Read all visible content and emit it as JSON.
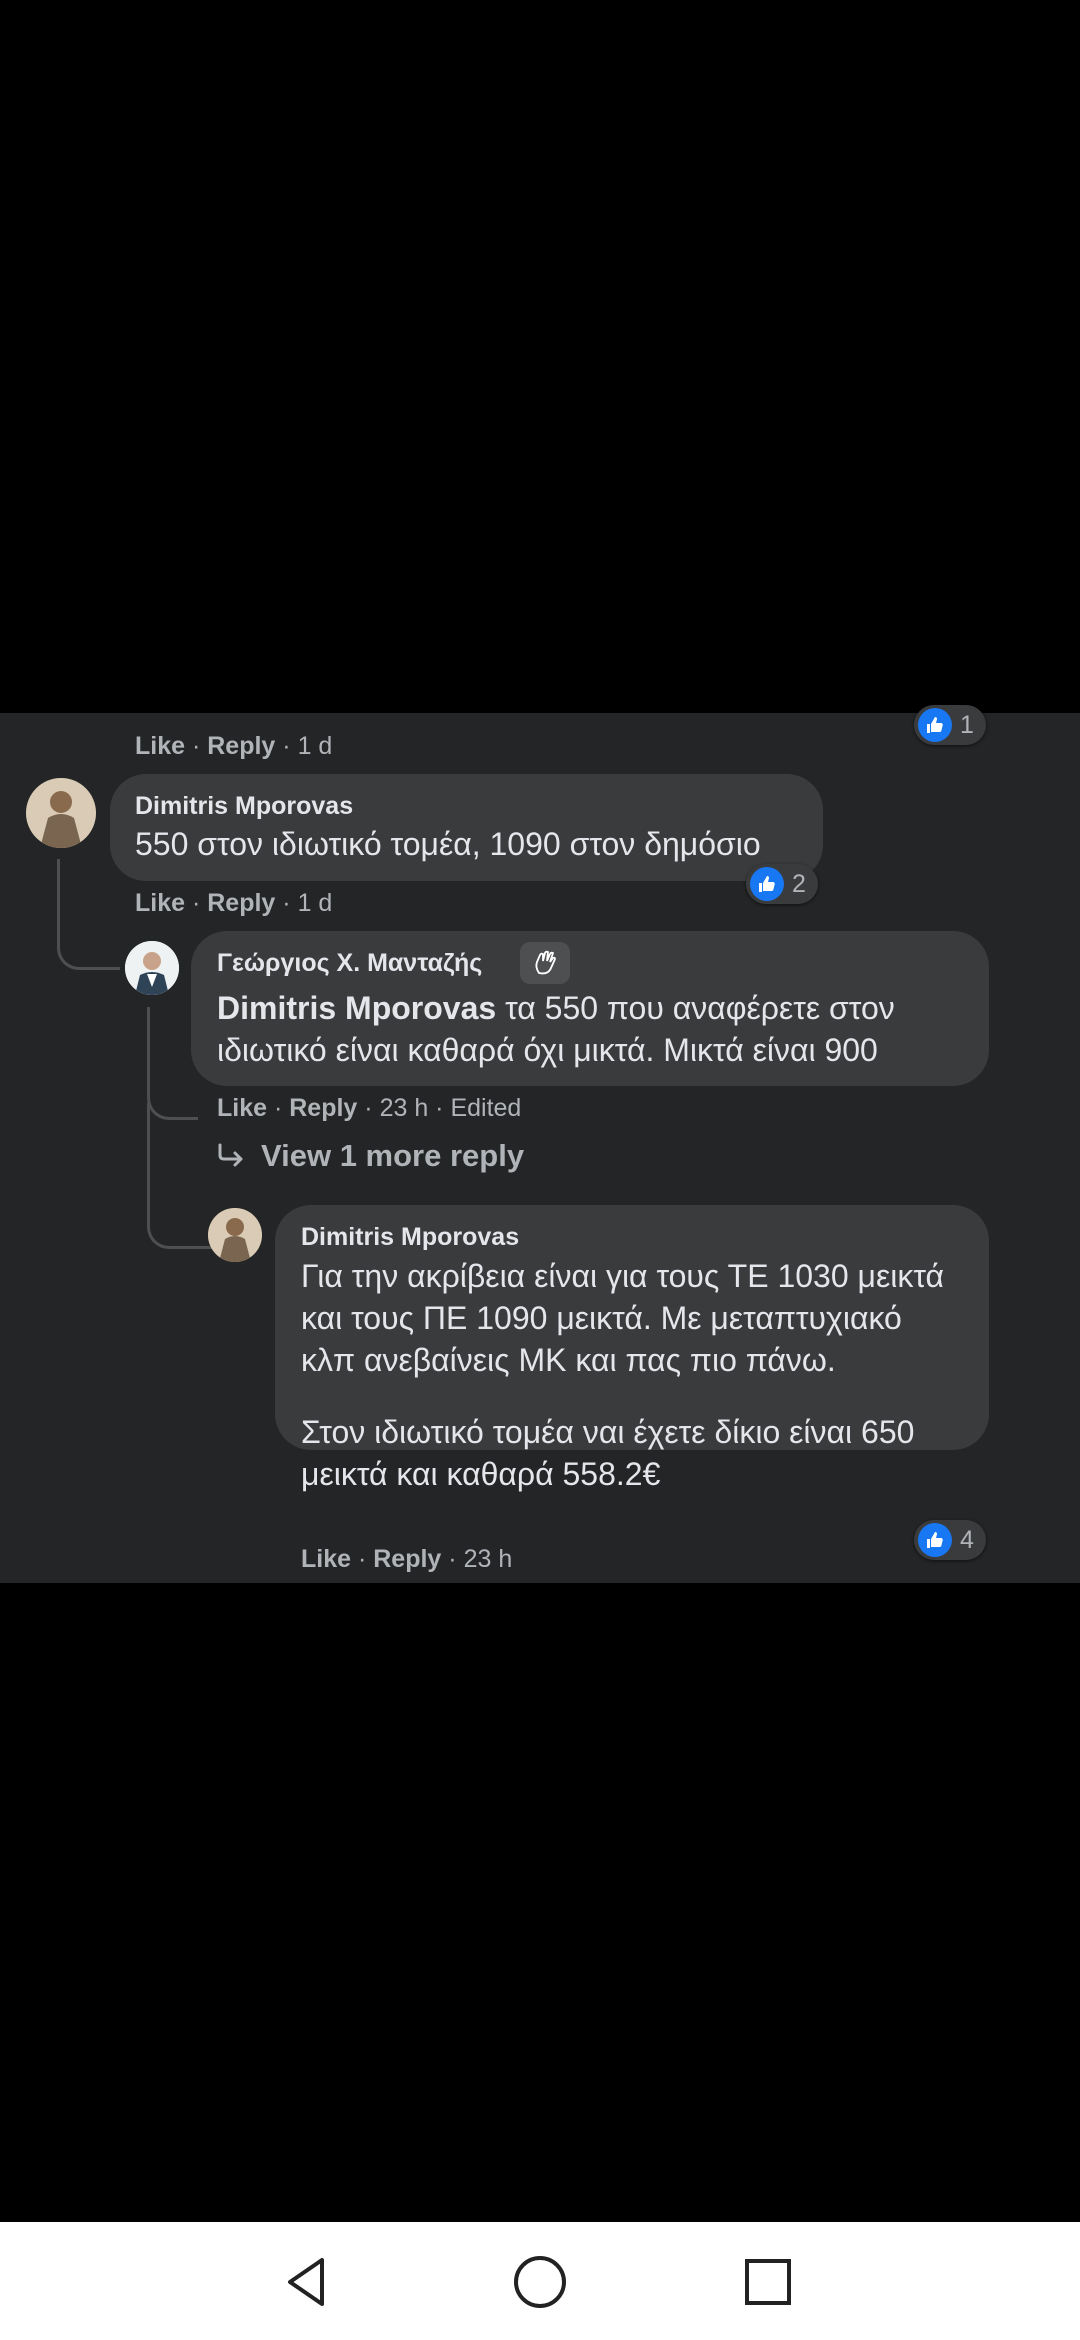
{
  "top_meta": {
    "like": "Like",
    "reply": "Reply",
    "time": "1 d"
  },
  "top_reaction": {
    "icon": "thumbs-up-icon",
    "count": "1"
  },
  "comment1": {
    "author": "Dimitris Mporovas",
    "text": "550 στον ιδιωτικό τομέα, 1090 στον δημόσιο",
    "reaction_count": "2",
    "like": "Like",
    "reply": "Reply",
    "time": "1 d"
  },
  "reply1": {
    "author": "Γεώργιος Χ. Μανταζής",
    "badge_icon": "wave-icon",
    "mention": "Dimitris Mporovas",
    "text": "τα 550 που αναφέρετε στον ιδιωτικό είναι καθαρά όχι μικτά. Μικτά είναι 900",
    "like": "Like",
    "reply": "Reply",
    "time": "23 h",
    "edited": "Edited"
  },
  "view_more": {
    "icon": "reply-arrow-icon",
    "label": "View 1 more reply"
  },
  "reply2": {
    "author": "Dimitris Mporovas",
    "paragraph1": "Για την ακρίβεια είναι για τους ΤΕ 1030 μεικτά και τους ΠΕ 1090 μεικτά. Με μεταπτυχιακό κλπ ανεβαίνεις ΜΚ και πας πιο πάνω.",
    "paragraph2": "Στον ιδιωτικό τομέα ναι έχετε δίκιο είναι 650 μεικτά και καθαρά 558.2€",
    "reaction_count": "4",
    "like": "Like",
    "reply": "Reply",
    "time": "23 h"
  },
  "navbar": {
    "back": "back-icon",
    "home": "home-icon",
    "recents": "recents-icon"
  },
  "colors": {
    "background": "#000000",
    "panel": "#242526",
    "bubble": "#3a3b3c",
    "accent": "#1877f2"
  }
}
